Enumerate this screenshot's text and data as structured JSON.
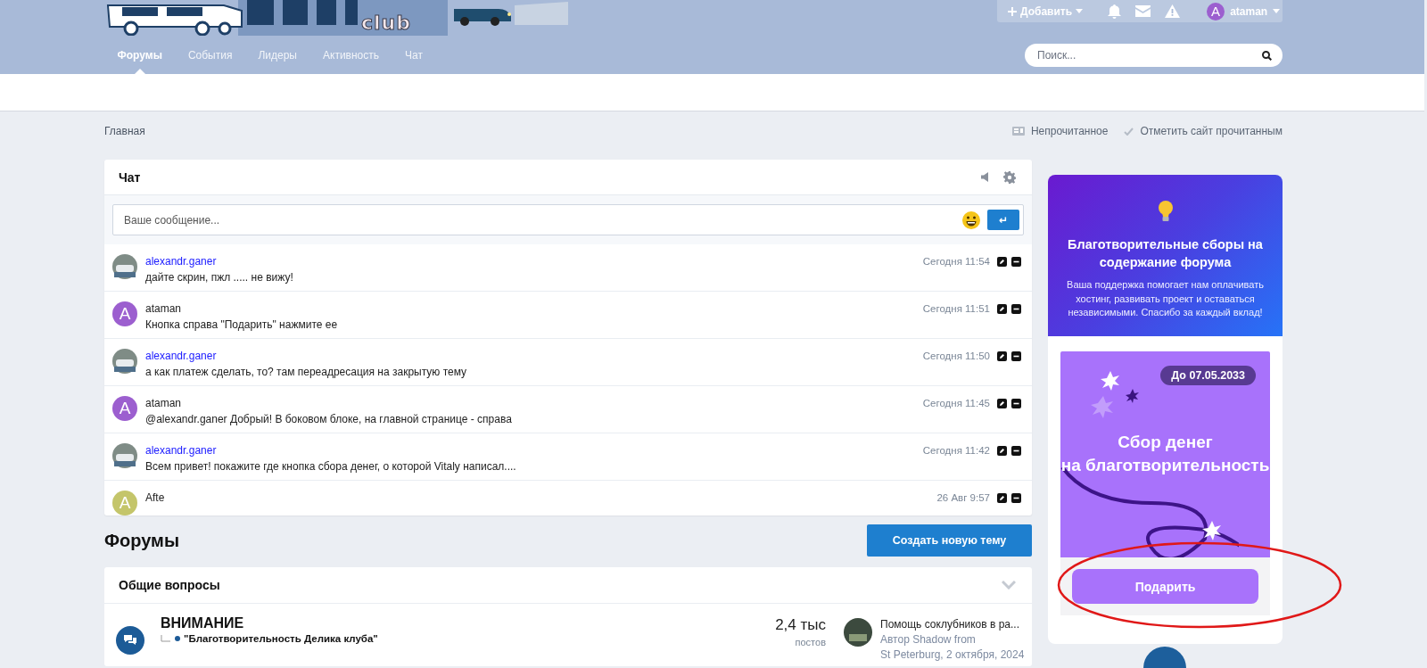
{
  "header": {
    "logo": {
      "text": "club"
    },
    "add_button": {
      "label": "Добавить"
    },
    "user": {
      "initial": "A",
      "name": "ataman"
    },
    "nav": [
      {
        "label": "Форумы",
        "selected": true
      },
      {
        "label": "События",
        "selected": false
      },
      {
        "label": "Лидеры",
        "selected": false
      },
      {
        "label": "Активность",
        "selected": false
      },
      {
        "label": "Чат",
        "selected": false
      }
    ],
    "search": {
      "placeholder": "Поиск..."
    }
  },
  "breadcrumb": [
    "Главная"
  ],
  "actions": [
    {
      "kind": "unread",
      "label": "Непрочитанное"
    },
    {
      "kind": "mark_read",
      "label": "Отметить сайт прочитанным"
    }
  ],
  "chat": {
    "title": "Чат",
    "input": {
      "placeholder": "Ваше сообщение..."
    },
    "send_label": "↵",
    "messages": [
      {
        "avatar": {
          "kind": "photo"
        },
        "author": {
          "name": "alexandr.ganer",
          "color": "#1a1aff"
        },
        "time": "Сегодня 11:54",
        "text": "дайте скрин, пжл ..... не вижу!"
      },
      {
        "avatar": {
          "kind": "letter",
          "initial": "A",
          "color": "#9c5fcf"
        },
        "author": {
          "name": "ataman",
          "color": "#222222"
        },
        "time": "Сегодня 11:51",
        "text": "Кнопка справа \"Подарить\" нажмите ее"
      },
      {
        "avatar": {
          "kind": "photo"
        },
        "author": {
          "name": "alexandr.ganer",
          "color": "#1a1aff"
        },
        "time": "Сегодня 11:50",
        "text": "а как платеж сделать, то? там переадресация на закрытую тему"
      },
      {
        "avatar": {
          "kind": "letter",
          "initial": "A",
          "color": "#9c5fcf"
        },
        "author": {
          "name": "ataman",
          "color": "#222222"
        },
        "time": "Сегодня 11:45",
        "text": "@alexandr.ganer Добрый! В боковом блоке, на главной странице - справа"
      },
      {
        "avatar": {
          "kind": "photo"
        },
        "author": {
          "name": "alexandr.ganer",
          "color": "#1a1aff"
        },
        "time": "Сегодня 11:42",
        "text": "Всем привет! покажите где кнопка сбора денег, о которой Vitaly написал...."
      },
      {
        "avatar": {
          "kind": "letter",
          "initial": "A",
          "color": "#c4c56a"
        },
        "author": {
          "name": "Afte",
          "color": "#222222"
        },
        "time": "26 Авг 9:57"
      }
    ]
  },
  "forums": {
    "title": "Форумы",
    "new_topic_button": "Создать новую тему",
    "categories": [
      {
        "title": "Общие вопросы",
        "expanded": true,
        "rows": [
          {
            "title": "ВНИМАНИЕ",
            "subforum": "\"Благотворительность Делика клуба\"",
            "stats": {
              "value": "2,4 тыс",
              "label": "постов"
            },
            "last_post": {
              "title": "Помощь соклубников в ра...",
              "author": "Автор Shadow from",
              "date": "St Peterburg, 2 октября, 2024"
            }
          }
        ]
      }
    ]
  },
  "donate": {
    "title": "Благотворительные сборы на содержание форума",
    "text": "Ваша поддержка помогает нам оплачивать хостинг, развивать проект и оставаться независимыми. Спасибо за каждый вклад!",
    "banner": {
      "date": "До 07.05.2033",
      "title_lines": [
        "Сбор денег",
        "на благотворительность"
      ]
    },
    "button": "Подарить"
  }
}
